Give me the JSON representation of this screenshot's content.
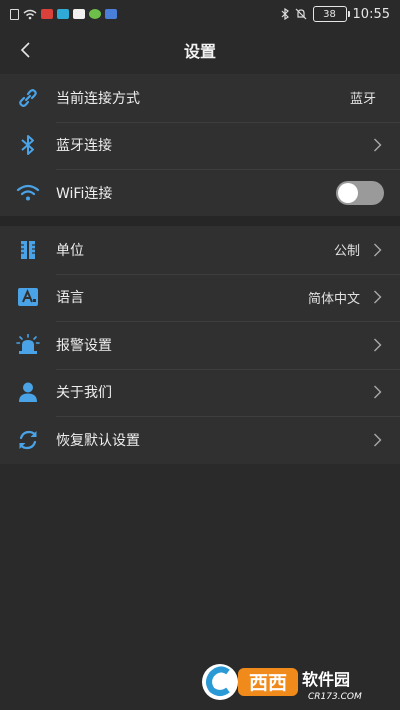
{
  "status_bar": {
    "time": "10:55",
    "battery": "38"
  },
  "header": {
    "title": "设置",
    "back_icon": "chevron-left-icon"
  },
  "groups": [
    {
      "rows": [
        {
          "icon": "link-icon",
          "label": "当前连接方式",
          "value": "蓝牙"
        },
        {
          "icon": "bluetooth-icon",
          "label": "蓝牙连接"
        },
        {
          "icon": "wifi-icon",
          "label": "WiFi连接",
          "toggle_on": false
        }
      ]
    },
    {
      "rows": [
        {
          "icon": "ruler-icon",
          "label": "单位",
          "value": "公制"
        },
        {
          "icon": "language-icon",
          "label": "语言",
          "value": "简体中文"
        },
        {
          "icon": "alarm-light-icon",
          "label": "报警设置"
        },
        {
          "icon": "user-icon",
          "label": "关于我们"
        },
        {
          "icon": "refresh-icon",
          "label": "恢复默认设置"
        }
      ]
    }
  ],
  "watermark": {
    "brand": "西西软件园",
    "url": "CR173.COM"
  },
  "colors": {
    "background": "#2a2a2a",
    "row_background": "#303030",
    "accent_icon": "#4aa3e6",
    "toggle_off": "#9a9a9a"
  }
}
